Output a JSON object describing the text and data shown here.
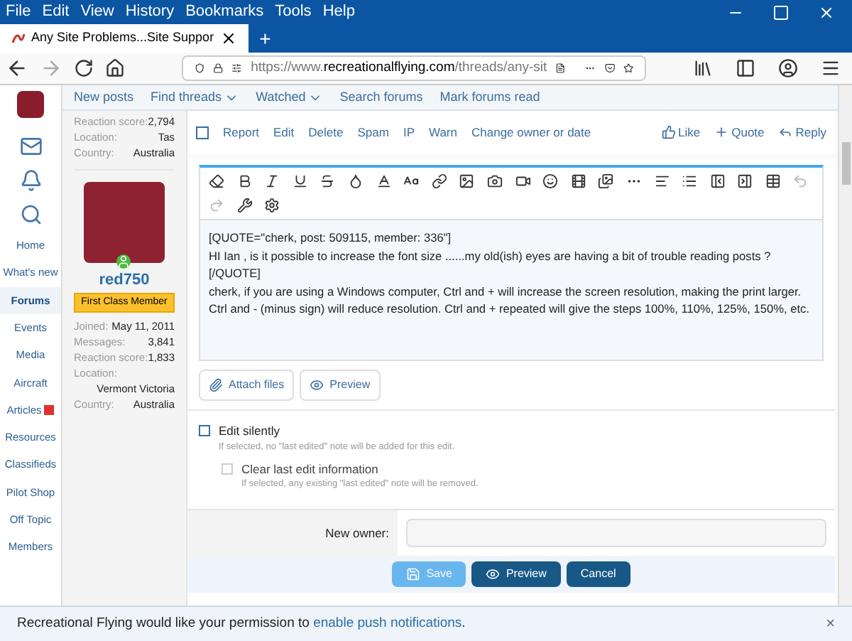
{
  "menu": [
    "File",
    "Edit",
    "View",
    "History",
    "Bookmarks",
    "Tools",
    "Help"
  ],
  "tab": {
    "title": "Any Site Problems...Site Suppor",
    "selected": true
  },
  "tab_add": "+",
  "address": {
    "prefix": "https://www.",
    "domain": "recreationalflying.com",
    "path": "/threads/any-sit"
  },
  "subnav": [
    {
      "label": "New posts",
      "dropdown": false
    },
    {
      "label": "Find threads",
      "dropdown": true
    },
    {
      "label": "Watched",
      "dropdown": true
    },
    {
      "label": "Search forums",
      "dropdown": false
    },
    {
      "label": "Mark forums read",
      "dropdown": false
    }
  ],
  "sidebar": {
    "items": [
      {
        "label": "Home",
        "selected": false
      },
      {
        "label": "What's new",
        "selected": false
      },
      {
        "label": "Forums",
        "selected": true
      },
      {
        "label": "Events",
        "selected": false
      },
      {
        "label": "Media",
        "selected": false
      },
      {
        "label": "Aircraft",
        "selected": false
      },
      {
        "label": "Articles",
        "selected": false,
        "badge": true
      },
      {
        "label": "Resources",
        "selected": false
      },
      {
        "label": "Classifieds",
        "selected": false
      },
      {
        "label": "Pilot Shop",
        "selected": false
      },
      {
        "label": "Off Topic",
        "selected": false
      },
      {
        "label": "Members",
        "selected": false
      }
    ]
  },
  "previous_post": {
    "select_checked": false,
    "stats": [
      {
        "label": "Reaction score:",
        "value": "2,794"
      },
      {
        "label": "Location:",
        "value": "Tas"
      },
      {
        "label": "Country:",
        "value": "Australia"
      }
    ],
    "actions": [
      "Report",
      "Edit",
      "Delete",
      "Spam",
      "IP",
      "Warn",
      "Change owner or date"
    ],
    "reactions": [
      {
        "kind": "like",
        "label": "Like"
      },
      {
        "kind": "quote",
        "label": "Quote"
      },
      {
        "kind": "reply",
        "label": "Reply"
      }
    ]
  },
  "user": {
    "name": "red750",
    "online": true,
    "title": "First Class Member",
    "stats": [
      {
        "label": "Joined:",
        "value": "May 11, 2011"
      },
      {
        "label": "Messages:",
        "value": "3,841"
      },
      {
        "label": "Reaction score:",
        "value": "1,833"
      },
      {
        "label": "Location:",
        "value": "Vermont Victoria"
      },
      {
        "label": "Country:",
        "value": "Australia"
      }
    ]
  },
  "editor": {
    "lines": [
      "[QUOTE=\"cherk, post: 509115, member: 336\"]",
      "HI Ian , is it possible to increase the font size ......my old(ish) eyes are having a bit of trouble reading posts ?",
      "[/QUOTE]",
      "cherk, if you are using a Windows computer, Ctrl and + will increase the screen resolution, making the print larger. Ctrl and - (minus sign) will reduce resolution. Ctrl and + repeated will give the steps 100%, 110%, 125%, 150%, etc."
    ]
  },
  "attach_buttons": [
    {
      "kind": "attach",
      "label": "Attach files"
    },
    {
      "kind": "preview",
      "label": "Preview"
    }
  ],
  "options": [
    {
      "label": "Edit silently",
      "hint": "If selected, no \"last edited\" note will be added for this edit.",
      "checked": false,
      "disabled": false
    },
    {
      "label": "Clear last edit information",
      "hint": "If selected, any existing \"last edited\" note will be removed.",
      "checked": false,
      "disabled": true
    }
  ],
  "new_owner": {
    "label": "New owner:"
  },
  "form_buttons": [
    {
      "kind": "save",
      "label": "Save",
      "disabled": true
    },
    {
      "kind": "preview",
      "label": "Preview",
      "disabled": false
    },
    {
      "kind": "cancel",
      "label": "Cancel",
      "disabled": false
    }
  ],
  "notice": {
    "text": "Recreational Flying would like your permission to ",
    "link": "enable push notifications",
    "end": ".",
    "close": "×"
  }
}
